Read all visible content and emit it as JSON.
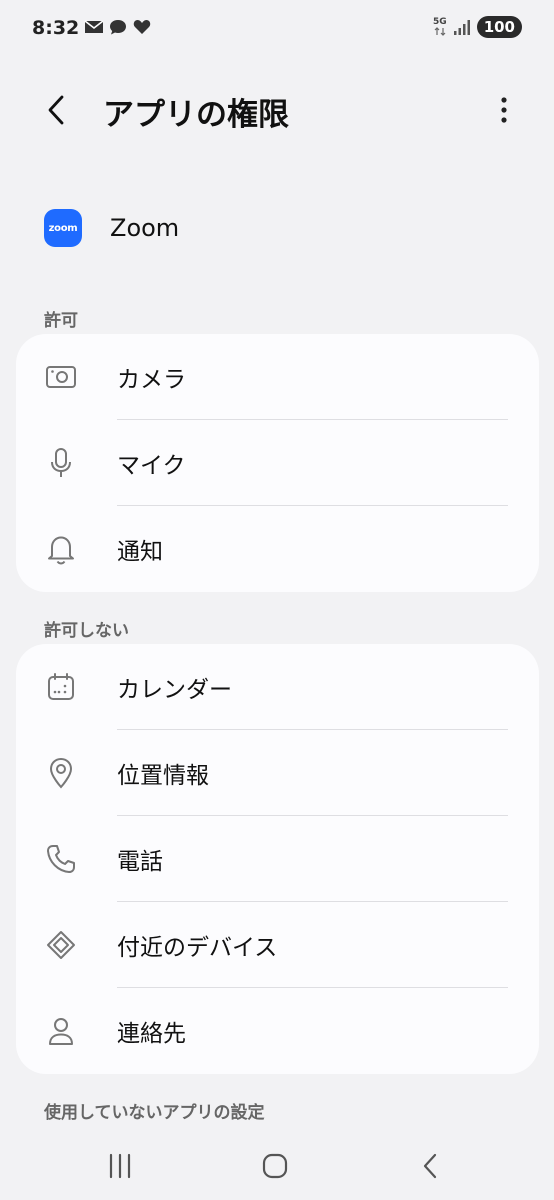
{
  "status_bar": {
    "time": "8:32",
    "network": "5G",
    "battery": "100"
  },
  "header": {
    "title": "アプリの権限"
  },
  "app": {
    "name": "Zoom",
    "icon_text": "zoom",
    "icon_color": "#1f6bff"
  },
  "allowed": {
    "label": "許可",
    "items": [
      {
        "label": "カメラ",
        "icon": "camera-icon"
      },
      {
        "label": "マイク",
        "icon": "mic-icon"
      },
      {
        "label": "通知",
        "icon": "bell-icon"
      }
    ]
  },
  "denied": {
    "label": "許可しない",
    "items": [
      {
        "label": "カレンダー",
        "icon": "calendar-icon"
      },
      {
        "label": "位置情報",
        "icon": "location-icon"
      },
      {
        "label": "電話",
        "icon": "phone-icon"
      },
      {
        "label": "付近のデバイス",
        "icon": "nearby-devices-icon"
      },
      {
        "label": "連絡先",
        "icon": "contacts-icon"
      }
    ]
  },
  "unused": {
    "label": "使用していないアプリの設定"
  }
}
